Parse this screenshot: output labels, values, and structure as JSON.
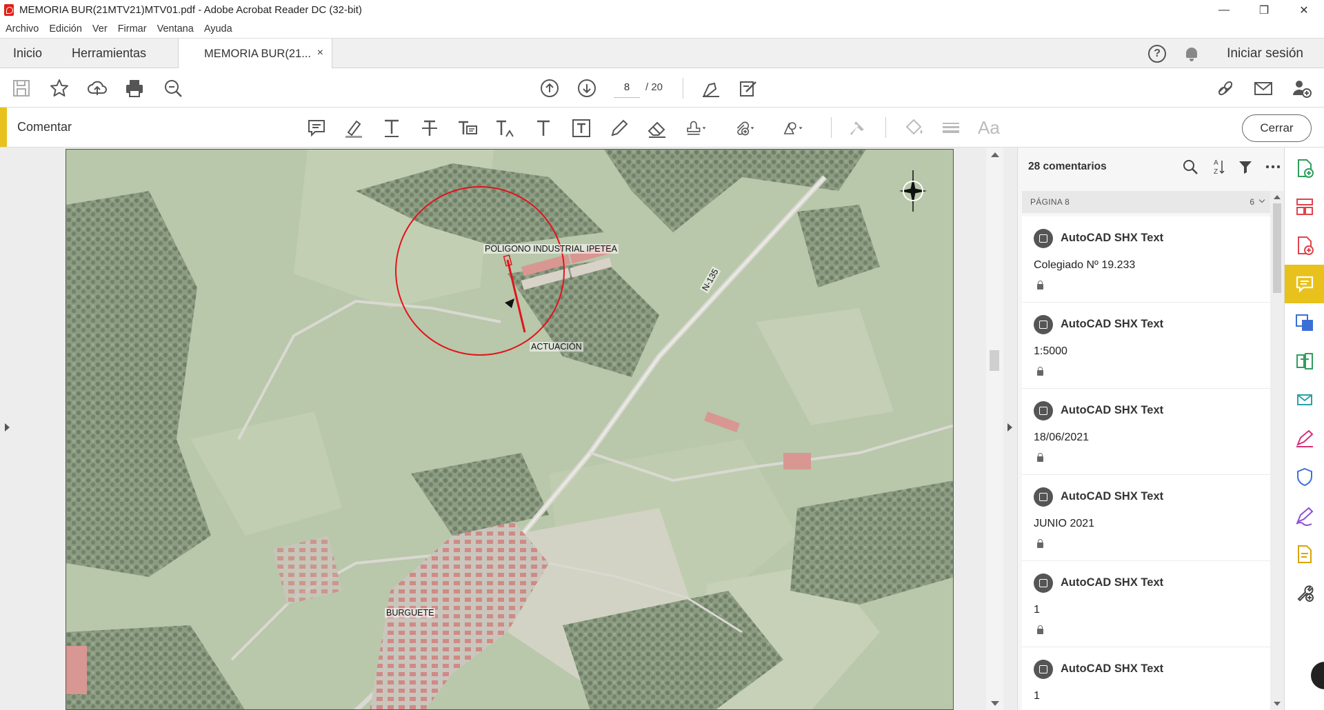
{
  "window": {
    "title": "MEMORIA BUR(21MTV21)MTV01.pdf - Adobe Acrobat Reader DC (32-bit)",
    "controls": [
      "—",
      "❐",
      "✕"
    ]
  },
  "menu": [
    "Archivo",
    "Edición",
    "Ver",
    "Firmar",
    "Ventana",
    "Ayuda"
  ],
  "tabs": {
    "home": "Inicio",
    "tools": "Herramientas",
    "document": "MEMORIA BUR(21...",
    "close": "×"
  },
  "account": {
    "signin": "Iniciar sesión",
    "help": "?"
  },
  "toolbar": {
    "page_current": "8",
    "page_total": "/ 20"
  },
  "comment_toolbar": {
    "label": "Comentar",
    "close_button": "Cerrar",
    "font_tool": "Aa"
  },
  "map": {
    "labels": {
      "industrial": "POLIGONO INDUSTRIAL IPETEA",
      "actuacion": "ACTUACIÓN",
      "road": "N-135",
      "town": "BURGUETE"
    },
    "annotation_color": "#e1141b"
  },
  "comments_panel": {
    "count_label": "28 comentarios",
    "page_label": "PÁGINA 8",
    "page_count": "6",
    "items": [
      {
        "author": "AutoCAD SHX Text",
        "text": "Colegiado Nº 19.233"
      },
      {
        "author": "AutoCAD SHX Text",
        "text": "1:5000"
      },
      {
        "author": "AutoCAD SHX Text",
        "text": "18/06/2021"
      },
      {
        "author": "AutoCAD SHX Text",
        "text": "JUNIO 2021"
      },
      {
        "author": "AutoCAD SHX Text",
        "text": "1"
      },
      {
        "author": "AutoCAD SHX Text",
        "text": "1"
      }
    ]
  },
  "colors": {
    "accent": "#e8c11c",
    "rail_green": "#2f9e5e",
    "rail_blue": "#3b6fd8",
    "rail_red": "#e0434b",
    "rail_pink": "#d5307a",
    "rail_purple": "#8c4fd6"
  }
}
